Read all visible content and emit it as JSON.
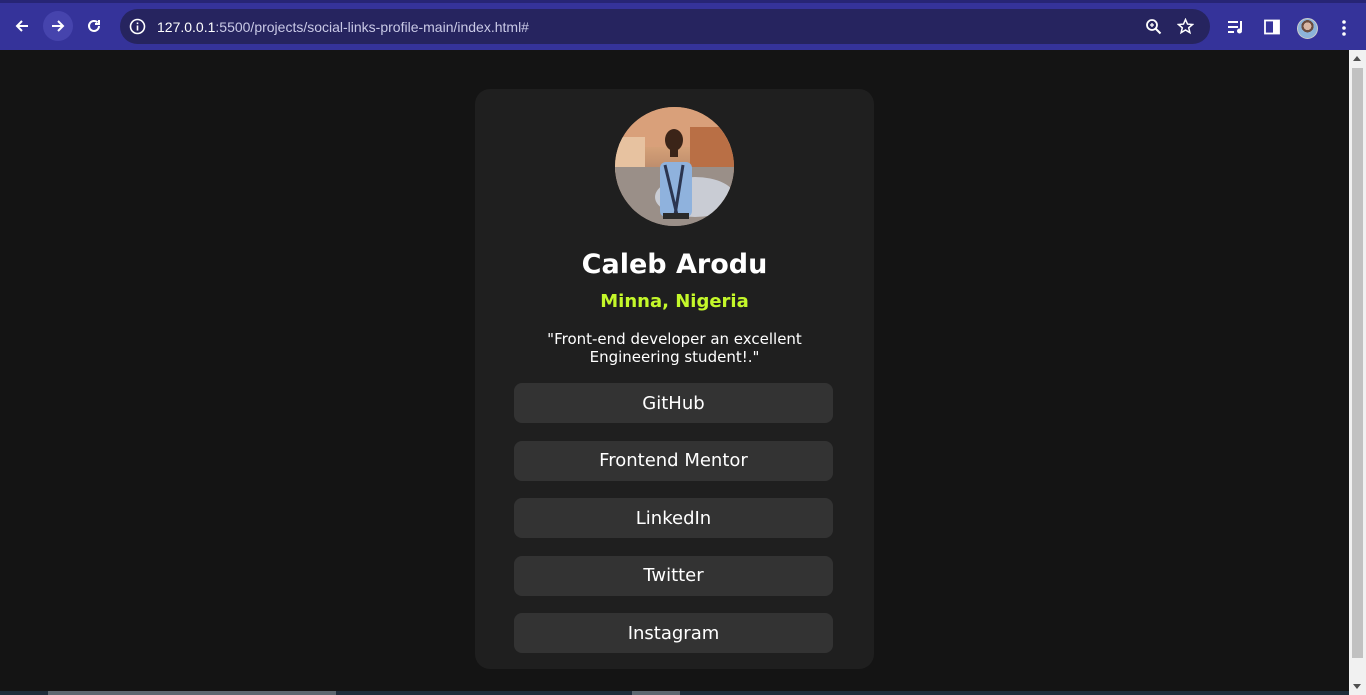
{
  "browser": {
    "url_host": "127.0.0.1",
    "url_rest": ":5500/projects/social-links-profile-main/index.html#",
    "icons": [
      "back-arrow-icon",
      "forward-arrow-icon",
      "reload-icon",
      "info-icon",
      "zoom-icon",
      "star-icon",
      "media-control-icon",
      "side-panel-icon",
      "profile-avatar",
      "more-menu-icon"
    ]
  },
  "profile": {
    "name": "Caleb Arodu",
    "location": "Minna, Nigeria",
    "bio": "\"Front-end developer an excellent Engineering student!.\""
  },
  "links": [
    {
      "label": "GitHub"
    },
    {
      "label": "Frontend Mentor"
    },
    {
      "label": "LinkedIn"
    },
    {
      "label": "Twitter"
    },
    {
      "label": "Instagram"
    }
  ],
  "colors": {
    "page_background": "#141414",
    "card_background": "#1f1f1f",
    "button_background": "#333333",
    "accent_green": "#c4f82a",
    "browser_chrome": "#35339a"
  }
}
